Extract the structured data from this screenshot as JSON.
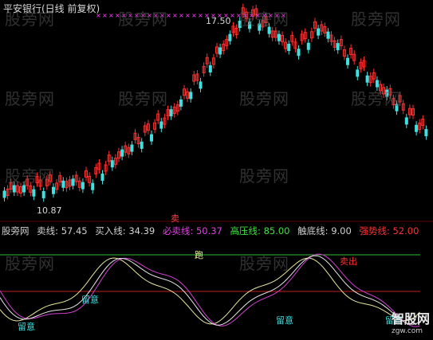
{
  "header": {
    "title": "平安银行(日线 前复权)"
  },
  "price_panel": {
    "high_label": "17.50",
    "low_label": "10.87"
  },
  "indicator_bar": {
    "name": "股旁网",
    "items": [
      {
        "label": "卖线:",
        "value": "57.45",
        "color": "#d0d0d0"
      },
      {
        "label": "买入线:",
        "value": "34.39",
        "color": "#d0d0d0"
      },
      {
        "label": "必卖线:",
        "value": "50.37",
        "color": "#e040e0"
      },
      {
        "label": "高压线:",
        "value": "85.00",
        "color": "#40e040"
      },
      {
        "label": "触底线:",
        "value": "9.00",
        "color": "#d0d0d0"
      },
      {
        "label": "强势线:",
        "value": "52.00",
        "color": "#ff3030"
      }
    ]
  },
  "annotations": {
    "pao": "跑",
    "zhuyi": "留意",
    "buy_marker": "卖",
    "mai_chu": "卖出"
  },
  "watermarks": [
    "股旁网",
    "股旁网",
    "股旁网",
    "股旁网",
    "股旁网",
    "股旁网",
    "股旁网",
    "股旁网",
    "股旁网",
    "股旁网",
    "股旁网",
    "股旁网"
  ],
  "logo": {
    "big": "智股网",
    "small": "zgw.com"
  },
  "colors": {
    "up": "#ff3030",
    "down": "#40e0e0",
    "sell": "#ff40ff",
    "line_buy": "#e8e8a0"
  }
}
